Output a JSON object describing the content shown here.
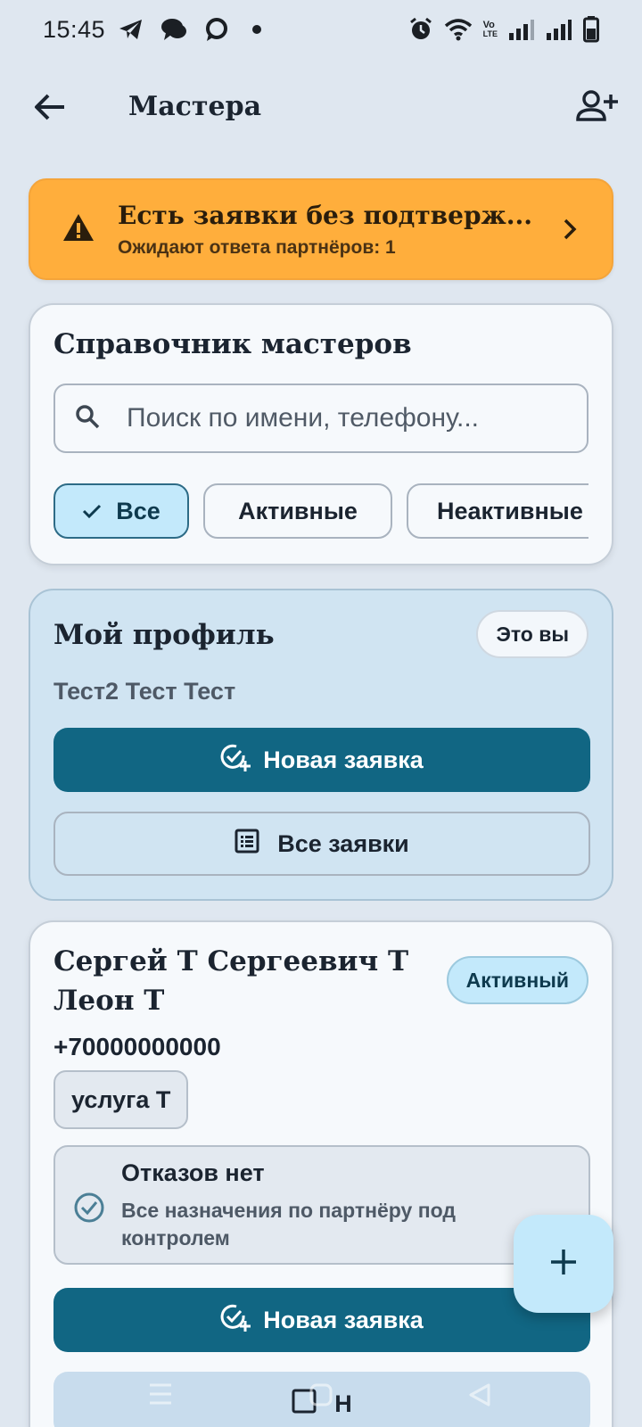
{
  "status_bar": {
    "time": "15:45",
    "left_icons": [
      "telegram-icon",
      "chat-bubbles-icon",
      "message-circle-icon",
      "dot-icon"
    ],
    "right_icons": [
      "alarm-icon",
      "wifi-icon",
      "volte-icon",
      "signal-icon",
      "signal-icon",
      "battery-icon"
    ],
    "volte_label_top": "Vo",
    "volte_label_bottom": "LTE"
  },
  "app_bar": {
    "title": "Мастера"
  },
  "warning": {
    "title": "Есть заявки без подтверж...",
    "subtitle": "Ожидают ответа партнёров: 1",
    "color": "#ffae3c"
  },
  "directory": {
    "title": "Справочник мастеров",
    "search_placeholder": "Поиск по имени, телефону...",
    "filters": [
      {
        "label": "Все",
        "selected": true
      },
      {
        "label": "Активные",
        "selected": false
      },
      {
        "label": "Неактивные",
        "selected": false
      }
    ]
  },
  "profile": {
    "title": "Мой профиль",
    "badge": "Это вы",
    "name": "Тест2 Тест Тест",
    "new_request_label": "Новая заявка",
    "all_requests_label": "Все заявки"
  },
  "master": {
    "name": "Сергей Т Сергеевич Т Леон Т",
    "status_badge": "Активный",
    "phone": "+70000000000",
    "service": "услуга Т",
    "status_title": "Отказов нет",
    "status_text": "Все назначения по партнёру под контролем",
    "new_request_label": "Новая заявка",
    "secondary_label": "Н"
  },
  "colors": {
    "primary": "#116683",
    "accent_light": "#c3e9fb",
    "background": "#dfe7f0"
  }
}
